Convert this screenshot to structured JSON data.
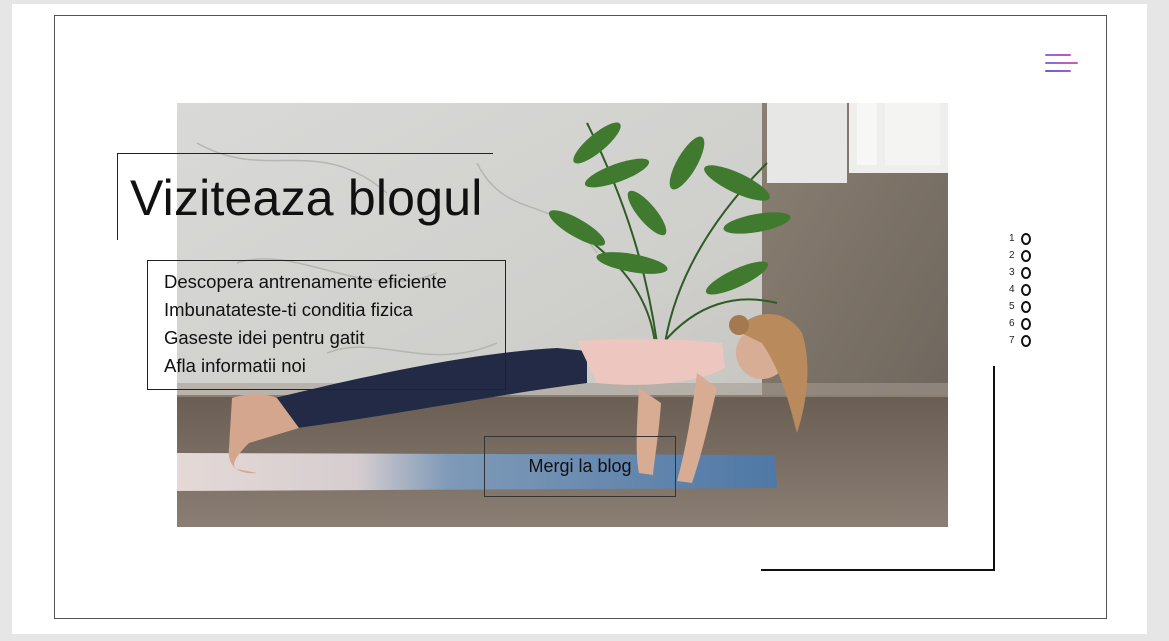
{
  "header": {
    "menu_icon": "hamburger-menu-icon"
  },
  "hero": {
    "title": "Viziteaza blogul",
    "features": [
      "Descopera antrenamente eficiente",
      "Imbunatateste-ti conditia fizica",
      "Gaseste idei pentru gatit",
      "Afla informatii noi"
    ],
    "cta_label": "Mergi la blog",
    "image_subject": "woman doing a yoga plank on a mat"
  },
  "pager": {
    "items": [
      "1",
      "2",
      "3",
      "4",
      "5",
      "6",
      "7"
    ]
  },
  "colors": {
    "accent_start": "#8a6ad8",
    "accent_end": "#d45aa8",
    "frame": "#555555"
  }
}
